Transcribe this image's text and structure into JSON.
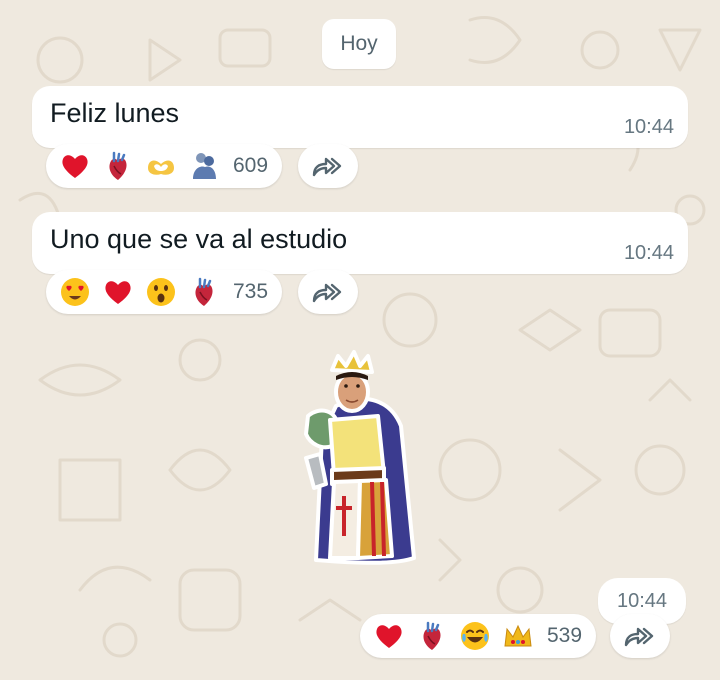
{
  "chat": {
    "date_chip": "Hoy",
    "messages": [
      {
        "text": "Feliz lunes",
        "time": "10:44",
        "reactions": [
          "red-heart",
          "anatomical-heart",
          "heart-hands",
          "people-hugging"
        ],
        "reaction_count": "609"
      },
      {
        "text": "Uno que se va al estudio",
        "time": "10:44",
        "reactions": [
          "heart-eyes-face",
          "red-heart",
          "astonished-face",
          "anatomical-heart"
        ],
        "reaction_count": "735"
      }
    ],
    "sticker": {
      "description": "king-character-sticker",
      "time": "10:44",
      "reactions": [
        "red-heart",
        "anatomical-heart",
        "tears-of-joy-face",
        "crown"
      ],
      "reaction_count": "539"
    }
  },
  "colors": {
    "wallpaper": "#efe9df",
    "bubble": "#ffffff",
    "time_text": "#667781",
    "count_text": "#54656f",
    "forward_icon": "#54656f"
  }
}
